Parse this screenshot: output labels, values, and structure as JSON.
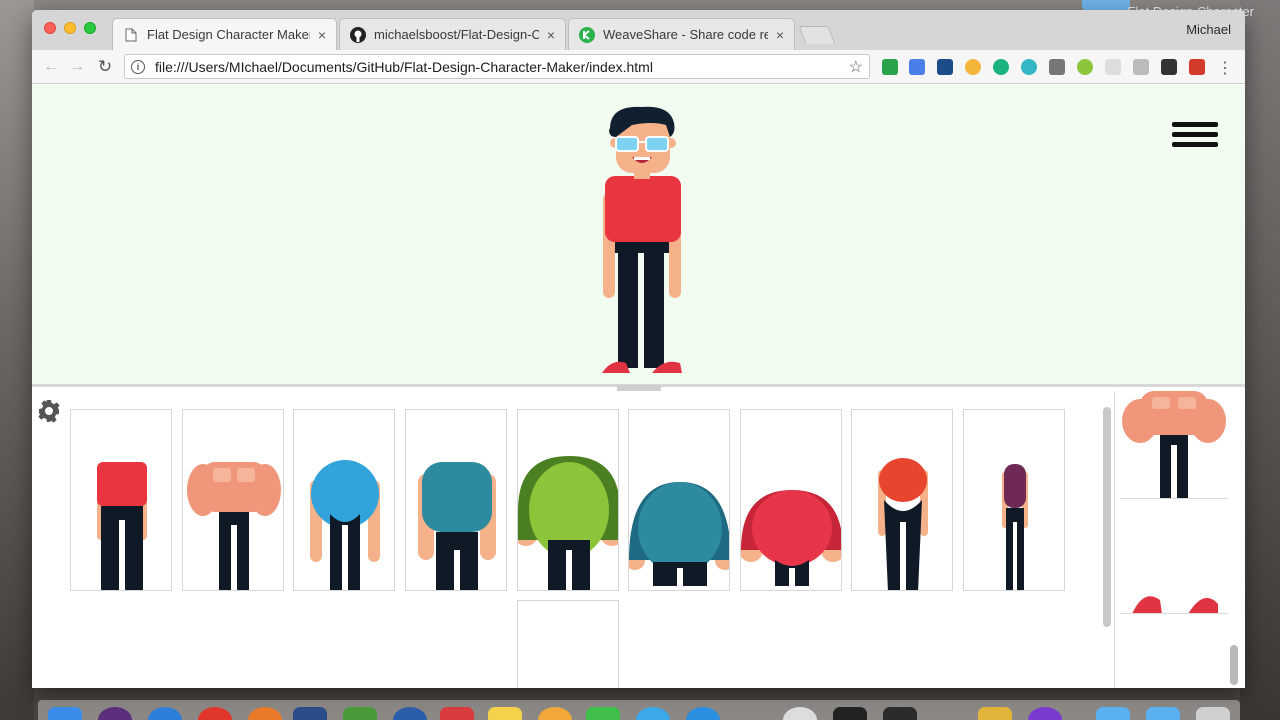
{
  "desktop": {
    "label": "Flat Design Character"
  },
  "browser": {
    "profile_name": "Michael",
    "tabs": [
      {
        "title": "Flat Design Character Maker",
        "close": "×",
        "active": true
      },
      {
        "title": "michaelsboost/Flat-Design-Ch",
        "close": "×",
        "active": false
      },
      {
        "title": "WeaveShare - Share code real",
        "close": "×",
        "active": false
      }
    ],
    "toolbar": {
      "back": "←",
      "forward": "→",
      "reload": "↻",
      "info": "i",
      "url": "file:///Users/MIchael/Documents/GitHub/Flat-Design-Character-Maker/index.html",
      "bookmark": "☆",
      "menu": "⋮"
    }
  },
  "app": {
    "character": {
      "hair": "#10202f",
      "skin": "#f5b189",
      "shirt": "#e8353f",
      "pants": "#0f1a26",
      "shoes": "#e03442",
      "glasses": "#7fd3f2"
    },
    "bodies": [
      {
        "name": "slim-red-shirt",
        "top": "#e8353f",
        "style": "slim"
      },
      {
        "name": "muscular",
        "top": "#f0977b",
        "style": "muscle"
      },
      {
        "name": "round-blue",
        "top": "#33a3dc",
        "style": "round"
      },
      {
        "name": "teal-top",
        "top": "#2e8a9e",
        "style": "boxy"
      },
      {
        "name": "green-big",
        "top": "#8cc43a",
        "style": "big"
      },
      {
        "name": "teal-dome",
        "top": "#2e8a9e",
        "style": "dome"
      },
      {
        "name": "red-dome",
        "top": "#e8354a",
        "style": "dome"
      },
      {
        "name": "orange-slim",
        "top": "#e8452f",
        "style": "slim2"
      },
      {
        "name": "purple-thin",
        "top": "#6e2a55",
        "style": "thin"
      }
    ]
  }
}
